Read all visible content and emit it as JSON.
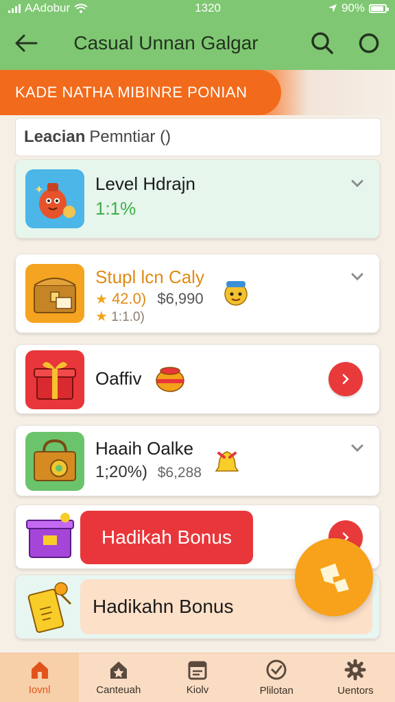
{
  "status_bar": {
    "carrier": "AAdobur",
    "time": "1320",
    "battery": "90%",
    "battery_level": 0.9
  },
  "app_bar": {
    "title": "Casual Unnan Galgar",
    "back_icon": "back-arrow-icon",
    "search_icon": "search-icon",
    "menu_icon": "circle-icon"
  },
  "banner": {
    "text": "KADE NATHA MIBINRE PONIAN",
    "color": "#f26a1b"
  },
  "search": {
    "bold_label": "Leacian",
    "label": "Pemntiar ()"
  },
  "cards": [
    {
      "title": "Level Hdrajn",
      "value": "1:1%",
      "value_color": "#3fae47",
      "icon": "character-icon",
      "action_icon": "chevron-down-icon"
    },
    {
      "title": "Stupl lcn Caly",
      "title_color": "#e08a12",
      "rating_1": "42.0)",
      "price": "$6,990",
      "rating_2": "1:1.0)",
      "icon": "treasure-chest-icon",
      "badge_icon": "mascot-icon",
      "action_icon": "chevron-down-icon"
    },
    {
      "title": "Oaffiv",
      "icon": "gift-box-icon",
      "badge_icon": "pot-icon",
      "action_icon": "chevron-right-icon"
    },
    {
      "title": "Haaih Oalke",
      "rating": "1;20%)",
      "price": "$6,288",
      "icon": "lock-chest-icon",
      "badge_icon": "bell-icon",
      "action_icon": "chevron-down-icon"
    },
    {
      "button_label": "Hadikah Bonus",
      "button_color": "#e8363a",
      "icon": "purple-gift-icon",
      "action_icon": "chevron-right-icon"
    },
    {
      "button_label": "Hadikahn Bonus",
      "icon": "ticket-icon"
    }
  ],
  "fab": {
    "icon": "ticket-fab-icon",
    "color": "#f7a21a"
  },
  "bottom_nav": [
    {
      "label": "Iovnl",
      "icon": "home-icon",
      "active": true
    },
    {
      "label": "Canteuah",
      "icon": "star-house-icon",
      "active": false
    },
    {
      "label": "Kiolv",
      "icon": "calendar-icon",
      "active": false
    },
    {
      "label": "Plilotan",
      "icon": "clock-icon",
      "active": false
    },
    {
      "label": "Uentors",
      "icon": "gear-icon",
      "active": false
    }
  ]
}
